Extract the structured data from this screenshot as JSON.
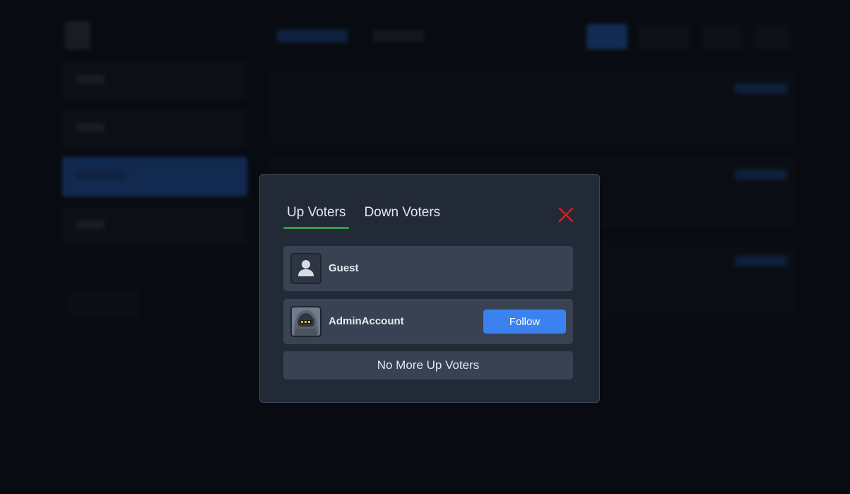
{
  "modal": {
    "tabs": [
      {
        "label": "Up Voters",
        "active": true
      },
      {
        "label": "Down Voters",
        "active": false
      }
    ],
    "close_icon": "close-icon",
    "voters": [
      {
        "name": "Guest",
        "avatar": "person-icon",
        "has_follow": false
      },
      {
        "name": "AdminAccount",
        "avatar": "helmet-avatar-image",
        "has_follow": true,
        "follow_label": "Follow"
      }
    ],
    "footer_button_label": "No More Up Voters"
  },
  "colors": {
    "accent_blue": "#3b82f0",
    "active_tab_underline": "#2e9e46",
    "close_red": "#d32020",
    "modal_bg": "#222a37",
    "row_bg": "#384253"
  }
}
